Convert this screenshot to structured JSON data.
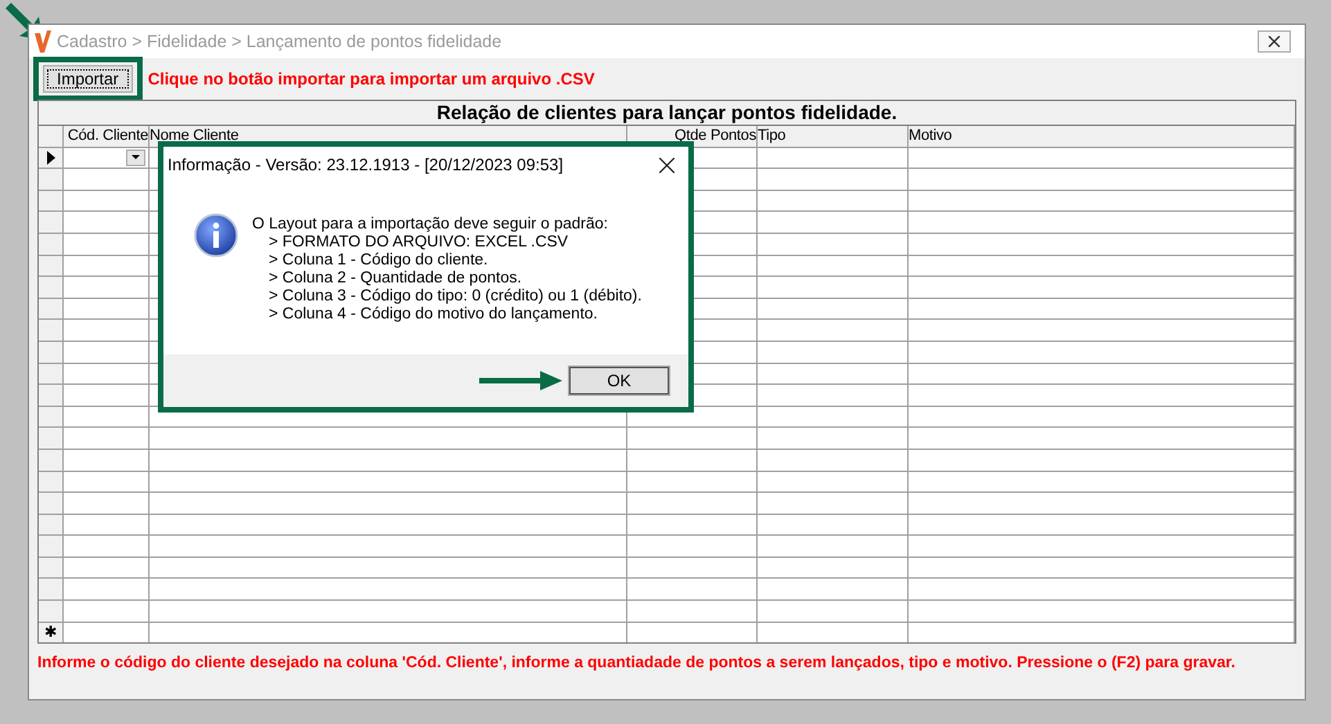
{
  "window": {
    "title": "Cadastro > Fidelidade > Lançamento de pontos fidelidade"
  },
  "toolbar": {
    "import_button": "Importar",
    "hint": "Clique no botão importar para importar um arquivo .CSV"
  },
  "grid": {
    "caption": "Relação de clientes para lançar pontos fidelidade.",
    "columns": [
      "Cód. Cliente",
      "Nome Cliente",
      "Qtde Pontos",
      "Tipo",
      "Motivo"
    ],
    "new_row_marker": "✱"
  },
  "footer_hint": "Informe o código do cliente desejado na coluna 'Cód. Cliente', informe a quantiadade de pontos a serem lançados, tipo e motivo. Pressione o (F2) para gravar.",
  "dialog": {
    "title": "Informação - Versão: 23.12.1913 - [20/12/2023 09:53]",
    "heading": "O Layout para a importação deve seguir o padrão:",
    "lines": [
      "> FORMATO DO ARQUIVO: EXCEL .CSV",
      "> Coluna 1 - Código do cliente.",
      "> Coluna 2 - Quantidade de pontos.",
      "> Coluna 3 - Código do tipo: 0 (crédito) ou 1 (débito).",
      "> Coluna 4 - Código do motivo do lançamento."
    ],
    "ok_button": "OK"
  }
}
